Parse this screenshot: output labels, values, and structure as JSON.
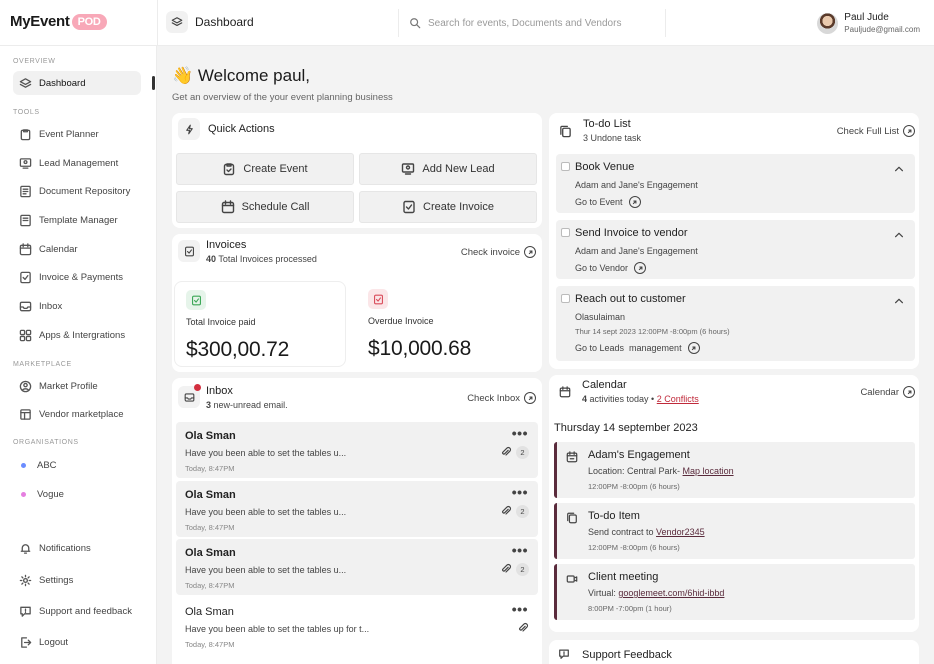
{
  "brand": {
    "name": "MyEvent",
    "badge": "POD"
  },
  "header": {
    "breadcrumb": "Dashboard",
    "search_placeholder": "Search for events, Documents and Vendors",
    "user_name": "Paul Jude",
    "user_email": "Pauljude@gmail.com"
  },
  "sidebar": {
    "overview_label": "OVERVIEW",
    "dashboard": "Dashboard",
    "tools_label": "TOOLS",
    "tools": [
      "Event Planner",
      "Lead Management",
      "Document Repository",
      "Template Manager",
      "Calendar",
      "Invoice & Payments",
      "Inbox",
      "Apps & Intergrations"
    ],
    "marketplace_label": "MARKETPLACE",
    "marketplace": [
      "Market Profile",
      "Vendor marketplace"
    ],
    "orgs_label": "ORGANISATIONS",
    "orgs": [
      {
        "name": "ABC",
        "color": "#6b8cff"
      },
      {
        "name": "Vogue",
        "color": "#e57fe0"
      }
    ],
    "bottom": [
      "Notifications",
      "Settings",
      "Support and feedback",
      "Logout"
    ]
  },
  "welcome": {
    "emoji": "👋",
    "title": "Welcome paul,",
    "subtitle": "Get an overview of the your event planning business"
  },
  "quick_actions": {
    "title": "Quick Actions",
    "buttons": [
      "Create Event",
      "Add New Lead",
      "Schedule Call",
      "Create Invoice"
    ]
  },
  "invoices": {
    "title": "Invoices",
    "count": "40",
    "count_text": "Total Invoices processed",
    "link": "Check invoice",
    "paid_label": "Total Invoice paid",
    "paid_amount": "$300,00.72",
    "overdue_label": "Overdue Invoice",
    "overdue_amount": "$10,000.68",
    "paid_color": "#3aa655",
    "overdue_color": "#d94b5a"
  },
  "inbox": {
    "title": "Inbox",
    "count": "3",
    "count_text": "new-unread email.",
    "link": "Check Inbox",
    "messages": [
      {
        "from": "Ola Sman",
        "snippet": "Have you been able to set the tables u...",
        "time": "Today, 8:47PM",
        "count": "2"
      },
      {
        "from": "Ola Sman",
        "snippet": "Have you been able to set the tables u...",
        "time": "Today, 8:47PM",
        "count": "2"
      },
      {
        "from": "Ola Sman",
        "snippet": "Have you been able to set the tables u...",
        "time": "Today, 8:47PM",
        "count": "2"
      },
      {
        "from": "Ola Sman",
        "snippet": "Have you been able to set the tables up for t...",
        "time": "Today, 8:47PM"
      }
    ]
  },
  "todo": {
    "title": "To-do List",
    "subtitle": "3 Undone task",
    "link": "Check Full List",
    "items": [
      {
        "title": "Book Venue",
        "sub": "Adam and Jane's Engagement",
        "go": "Go to Event"
      },
      {
        "title": "Send Invoice to vendor",
        "sub": "Adam and Jane's Engagement",
        "go": "Go to Vendor"
      },
      {
        "title": "Reach out to customer",
        "sub": "Olasulaiman",
        "date": "Thur 14 sept 2023 12:00PM -8:00pm (6 hours)",
        "go": "Go to Leads  management"
      }
    ]
  },
  "calendar": {
    "title": "Calendar",
    "count": "4",
    "count_text": "activities today •",
    "conflicts": "2 Conflicts",
    "link": "Calendar",
    "date": "Thursday 14 september 2023",
    "events": [
      {
        "title": "Adam's Engagement",
        "prefix": "Location: Central Park- ",
        "link": "Map location",
        "time": "12:00PM -8:00pm (6 hours)"
      },
      {
        "title": "To-do Item",
        "prefix": "Send contract to ",
        "link": "Vendor2345",
        "time": "12:00PM -8:00pm (6 hours)"
      },
      {
        "title": "Client meeting",
        "prefix": "Virtual: ",
        "link": "googlemeet.com/6hid-ibbd",
        "time": "8:00PM -7:00pm (1 hour)"
      }
    ]
  },
  "support": {
    "title": "Support Feedback"
  }
}
